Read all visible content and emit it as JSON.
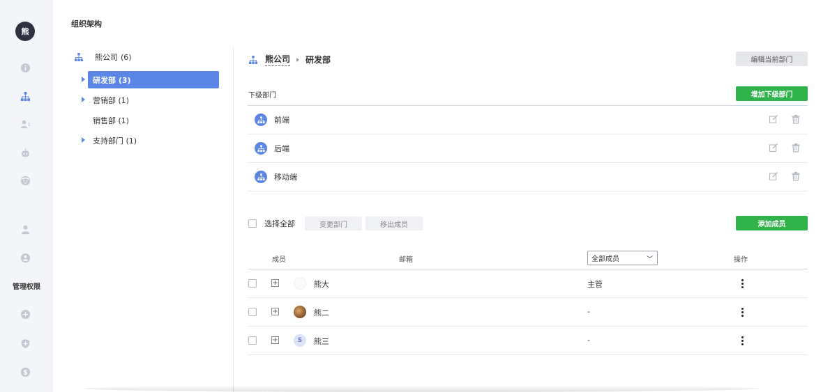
{
  "rail": {
    "logo_text": "熊",
    "section_label": "管理权限",
    "icons": [
      "info-icon",
      "org-tree-icon",
      "contacts-icon",
      "bot-icon",
      "face-icon",
      "user-icon",
      "user-settings-icon",
      "add-circle-icon",
      "shield-icon",
      "dollar-icon"
    ]
  },
  "page": {
    "title": "组织架构"
  },
  "tree": {
    "root": {
      "name": "熊公司",
      "count": "(6)"
    },
    "nodes": [
      {
        "label": "研发部 (3)",
        "expandable": true,
        "active": true
      },
      {
        "label": "营销部 (1)",
        "expandable": true,
        "active": false
      },
      {
        "label": "销售部 (1)",
        "expandable": false,
        "active": false
      },
      {
        "label": "支持部门 (1)",
        "expandable": true,
        "active": false
      }
    ]
  },
  "breadcrumb": {
    "root": "熊公司",
    "current": "研发部"
  },
  "buttons": {
    "edit_dept": "编辑当前部门",
    "add_sub_dept": "增加下级部门",
    "change_dept": "变更部门",
    "remove_member": "移出成员",
    "add_member": "添加成员"
  },
  "sub_departments": {
    "title": "下级部门",
    "items": [
      "前端",
      "后端",
      "移动端"
    ]
  },
  "members": {
    "select_all": "选择全部",
    "columns": {
      "member": "成员",
      "email": "邮箱",
      "actions": "操作"
    },
    "filter_selected": "全部成员",
    "rows": [
      {
        "name": "熊大",
        "role": "主管",
        "avatar": "light"
      },
      {
        "name": "熊二",
        "role": "-",
        "avatar": "photo"
      },
      {
        "name": "熊三",
        "role": "-",
        "avatar": "letter",
        "avatar_letter": "S"
      }
    ]
  },
  "colors": {
    "accent": "#5b86e5",
    "green": "#2fb34a",
    "rail_bg": "#f4f5f8"
  }
}
